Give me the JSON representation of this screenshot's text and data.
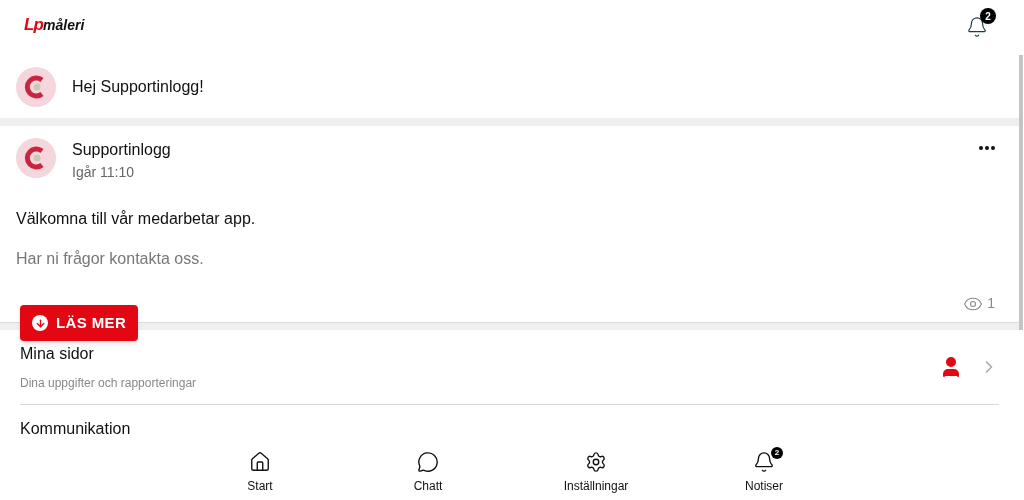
{
  "header": {
    "logo": {
      "mark": "Lp",
      "name": "måleri"
    },
    "notification_badge": "2"
  },
  "greeting": {
    "text": "Hej Supportinlogg!"
  },
  "post": {
    "author": "Supportinlogg",
    "time": "Igår 11:10",
    "title": "Välkomna till vår medarbetar app.",
    "body": "Har ni frågor kontakta oss.",
    "views": "1",
    "read_more": "LÄS MER"
  },
  "menu": [
    {
      "title": "Mina sidor",
      "subtitle": "Dina uppgifter och rapporteringar"
    },
    {
      "title": "Kommunikation"
    }
  ],
  "bottom_nav": [
    {
      "kind": "home",
      "label": "Start"
    },
    {
      "kind": "chat",
      "label": "Chatt"
    },
    {
      "kind": "settings",
      "label": "Inställningar"
    },
    {
      "kind": "bell",
      "label": "Notiser",
      "badge": "2"
    }
  ]
}
